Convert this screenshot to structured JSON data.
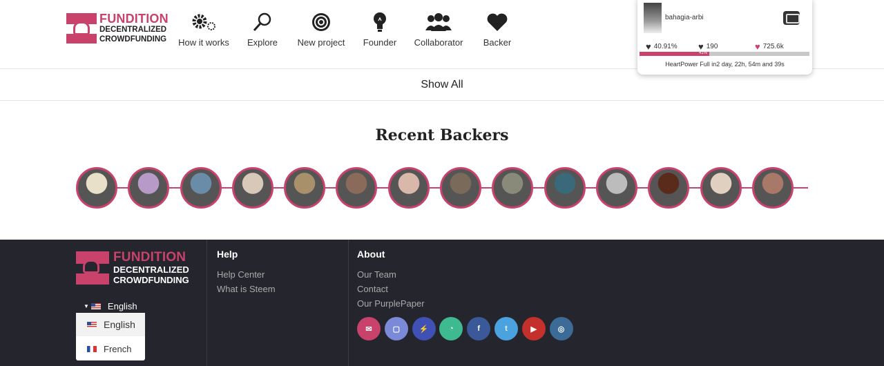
{
  "header": {
    "brand": "FUNDITION",
    "tagline_1": "DECENTRALIZED",
    "tagline_2": "CROWDFUNDING",
    "nav": [
      {
        "label": "How it works",
        "icon": "gears-icon"
      },
      {
        "label": "Explore",
        "icon": "search-icon"
      },
      {
        "label": "New project",
        "icon": "target-icon"
      },
      {
        "label": "Founder",
        "icon": "lightbulb-icon"
      },
      {
        "label": "Collaborator",
        "icon": "group-icon"
      },
      {
        "label": "Backer",
        "icon": "heart-icon"
      }
    ]
  },
  "user": {
    "name": "bahagia-arbi",
    "stat_1": "40.91%",
    "stat_2": "190",
    "stat_3": "725.6k",
    "power_pct_label": "41%",
    "power_fraction": 0.41,
    "power_text": "HeartPower Full in2 day, 22h, 54m and 39s"
  },
  "show_all": "Show All",
  "recent_backers": {
    "title": "Recent Backers",
    "count": 14
  },
  "footer": {
    "brand": "FUNDITION",
    "tagline_1": "DECENTRALIZED",
    "tagline_2": "CROWDFUNDING",
    "help": {
      "title": "Help",
      "links": [
        "Help Center",
        "What is Steem"
      ]
    },
    "about": {
      "title": "About",
      "links": [
        "Our Team",
        "Contact",
        "Our PurplePaper"
      ]
    },
    "language": {
      "current": "English",
      "options": [
        "English",
        "French"
      ]
    },
    "socials": [
      {
        "name": "email",
        "color": "#c8426b"
      },
      {
        "name": "chat",
        "color": "#7a8ad8"
      },
      {
        "name": "steemit",
        "color": "#3f51b5"
      },
      {
        "name": "comment",
        "color": "#3fb98f"
      },
      {
        "name": "facebook",
        "color": "#3b5998"
      },
      {
        "name": "twitter",
        "color": "#4aa3df"
      },
      {
        "name": "youtube",
        "color": "#c4302b"
      },
      {
        "name": "instagram",
        "color": "#3b6b96"
      }
    ]
  }
}
